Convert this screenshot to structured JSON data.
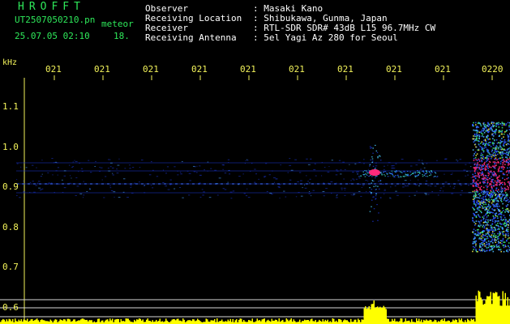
{
  "header": {
    "title": "HROFFT",
    "file": "UT2507050210.pn",
    "kind": "meteor",
    "datetime": "25.07.05 02:10",
    "number": "18.",
    "fields": [
      {
        "label": "Observer",
        "value": ": Masaki Kano"
      },
      {
        "label": "Receiving Location",
        "value": ": Shibukawa, Gunma, Japan"
      },
      {
        "label": "Receiver",
        "value": ": RTL-SDR SDR# 43dB L15 96.7MHz CW"
      },
      {
        "label": "Receiving Antenna",
        "value": ": 5el Yagi Az 280 for Seoul"
      }
    ]
  },
  "y_axis": {
    "unit": "kHz",
    "ticks": [
      "1.1",
      "1.0",
      "0.9",
      "0.8",
      "0.7",
      "0.6"
    ]
  },
  "x_axis": {
    "ticks": [
      "021",
      "021",
      "021",
      "021",
      "021",
      "021",
      "021",
      "021",
      "021",
      "0220"
    ]
  },
  "colors": {
    "background": "#000000",
    "label_green": "#2ee85a",
    "label_white": "#ffffff",
    "tick_yellow": "#f2f25a",
    "noise_blue": "#1b33c8",
    "signal_pink": "#ff2a7a",
    "amplitude_yellow": "#ffff00"
  }
}
